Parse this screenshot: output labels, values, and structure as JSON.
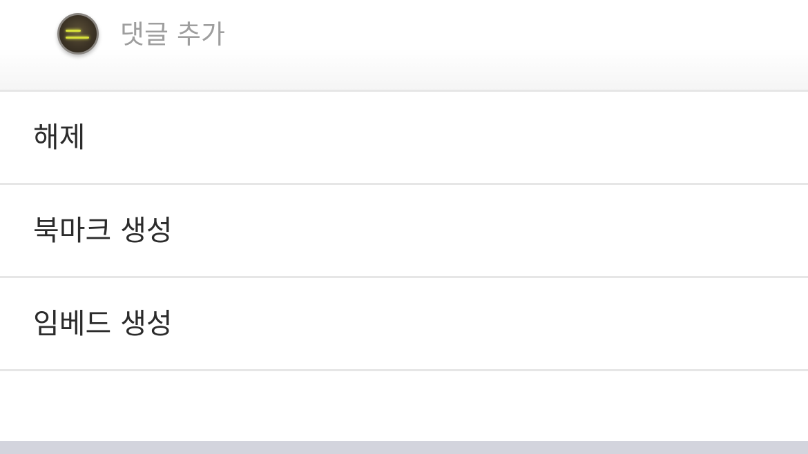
{
  "comment": {
    "placeholder": "댓글 추가"
  },
  "menu": {
    "items": [
      {
        "label": "해제"
      },
      {
        "label": "북마크 생성"
      },
      {
        "label": "임베드 생성"
      }
    ]
  }
}
